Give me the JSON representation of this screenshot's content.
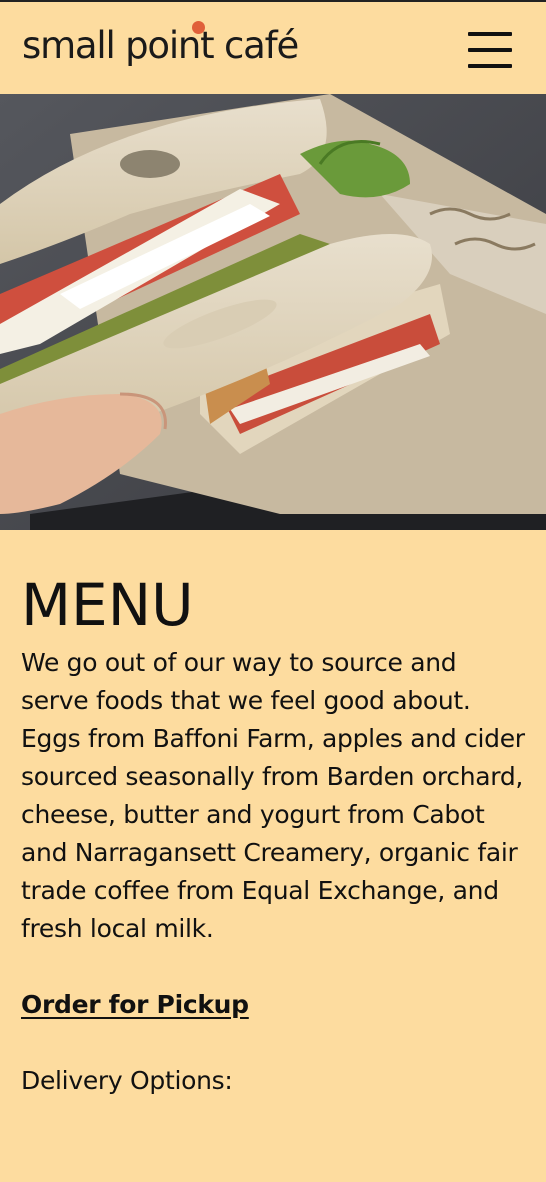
{
  "header": {
    "logo_text": "small point café",
    "menu_icon": "hamburger-menu-icon"
  },
  "hero": {
    "image": "sandwich-photo"
  },
  "main": {
    "title": "MENU",
    "intro": "We go out of our way to source and serve foods that we feel good about. Eggs from Baffoni Farm, apples and cider sourced seasonally from Barden orchard, cheese, butter and yogurt from Cabot and Narragansett Creamery, organic fair trade coffee from Equal Exchange, and fresh local milk.",
    "order_link_label": "Order for Pickup",
    "delivery_label": "Delivery Options:"
  },
  "colors": {
    "background": "#fddc9f",
    "logo_dot": "#e0603a",
    "text": "#111111"
  }
}
